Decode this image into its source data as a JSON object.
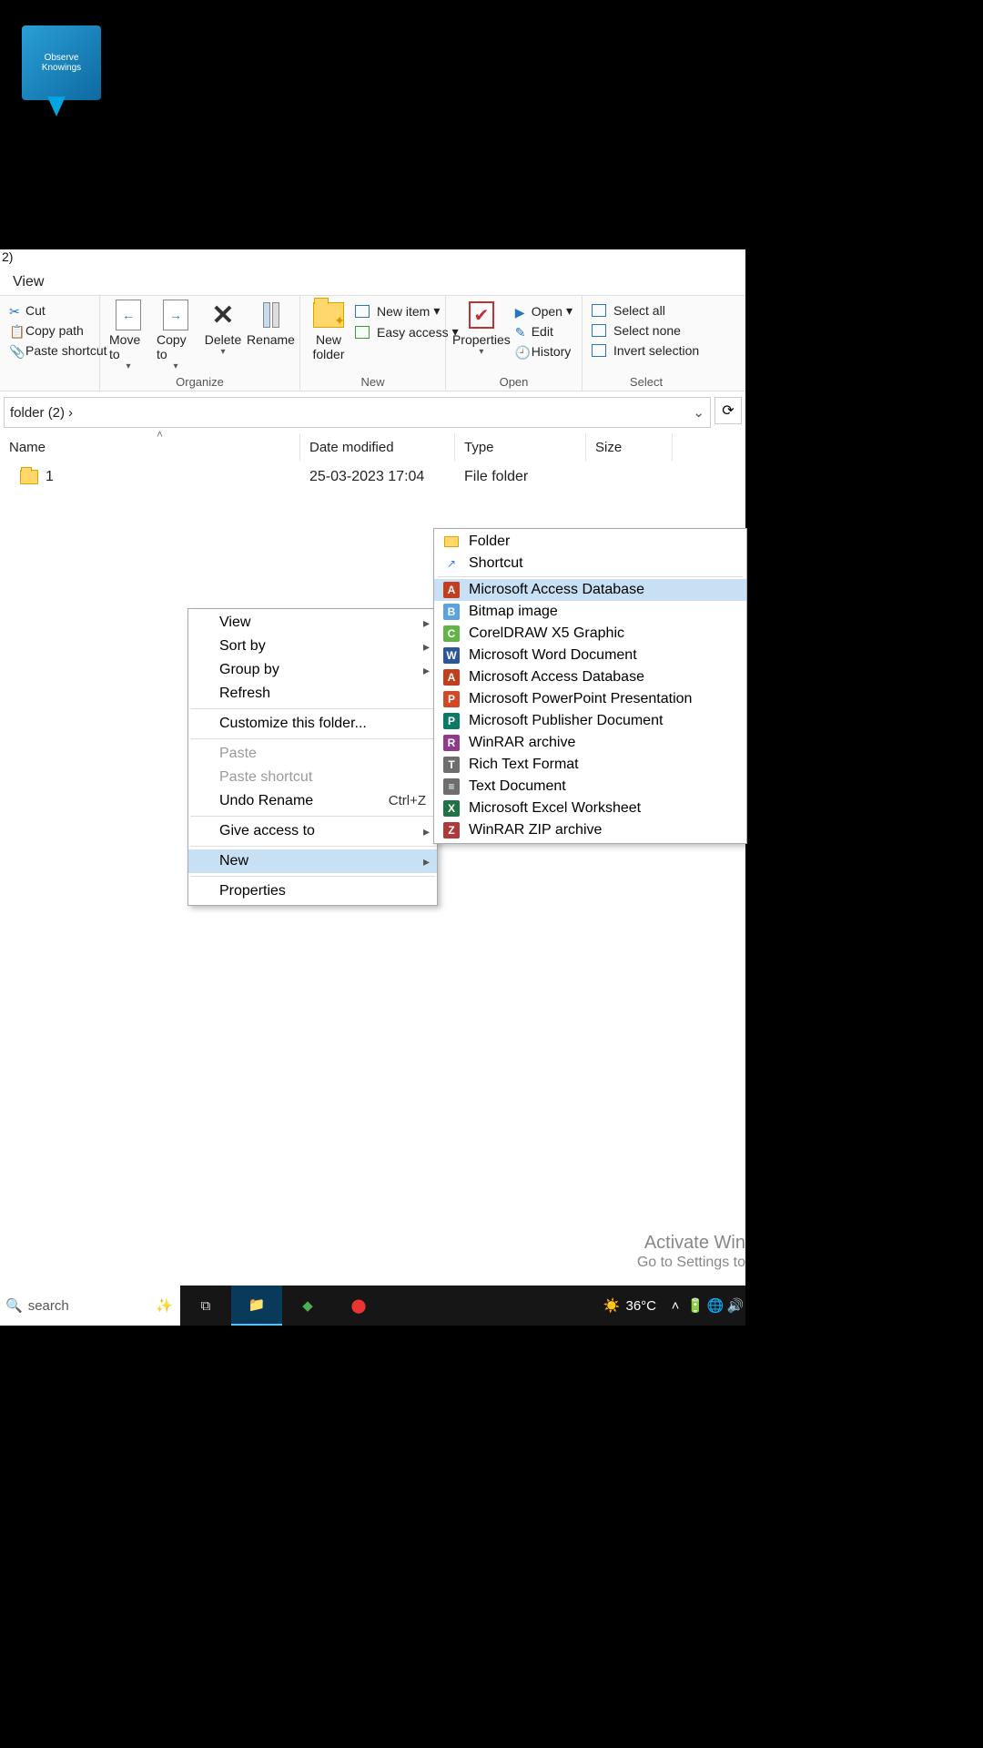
{
  "desktop": {
    "icon_label": "Observe Knowings"
  },
  "title": "2)",
  "tabs": {
    "view": "View"
  },
  "ribbon": {
    "clipboard": {
      "cut": "Cut",
      "copy_path": "Copy path",
      "paste_shortcut": "Paste shortcut"
    },
    "organize": {
      "move_to": "Move to",
      "copy_to": "Copy to",
      "delete": "Delete",
      "rename": "Rename",
      "group": "Organize"
    },
    "new": {
      "new_folder": "New folder",
      "new_item": "New item",
      "easy_access": "Easy access",
      "group": "New"
    },
    "open": {
      "properties": "Properties",
      "open": "Open",
      "edit": "Edit",
      "history": "History",
      "group": "Open"
    },
    "select": {
      "select_all": "Select all",
      "select_none": "Select none",
      "invert": "Invert selection",
      "group": "Select"
    }
  },
  "address": {
    "crumb": "folder (2)",
    "chev": "›"
  },
  "columns": {
    "name": "Name",
    "date": "Date modified",
    "type": "Type",
    "size": "Size"
  },
  "rows": [
    {
      "name": "1",
      "date": "25-03-2023 17:04",
      "type": "File folder"
    }
  ],
  "context_menu": {
    "items": [
      {
        "label": "View",
        "sub": true
      },
      {
        "label": "Sort by",
        "sub": true
      },
      {
        "label": "Group by",
        "sub": true
      },
      {
        "label": "Refresh"
      },
      {
        "sep": true
      },
      {
        "label": "Customize this folder..."
      },
      {
        "sep": true
      },
      {
        "label": "Paste",
        "disabled": true
      },
      {
        "label": "Paste shortcut",
        "disabled": true
      },
      {
        "label": "Undo Rename",
        "kb": "Ctrl+Z"
      },
      {
        "sep": true
      },
      {
        "label": "Give access to",
        "sub": true
      },
      {
        "sep": true
      },
      {
        "label": "New",
        "sub": true,
        "highlight": true
      },
      {
        "sep": true
      },
      {
        "label": "Properties"
      }
    ]
  },
  "new_submenu": [
    {
      "label": "Folder",
      "icon": "folder",
      "color": "#ffd76a"
    },
    {
      "label": "Shortcut",
      "icon": "shortcut",
      "color": "#3a7bd5"
    },
    {
      "sep": true
    },
    {
      "label": "Microsoft Access Database",
      "icon": "A",
      "color": "#c43e1c",
      "hl": true
    },
    {
      "label": "Bitmap image",
      "icon": "B",
      "color": "#5aa3e0"
    },
    {
      "label": "CorelDRAW X5 Graphic",
      "icon": "C",
      "color": "#63b446"
    },
    {
      "label": "Microsoft Word Document",
      "icon": "W",
      "color": "#2b579a"
    },
    {
      "label": "Microsoft Access Database",
      "icon": "A",
      "color": "#c43e1c"
    },
    {
      "label": "Microsoft PowerPoint Presentation",
      "icon": "P",
      "color": "#d24726"
    },
    {
      "label": "Microsoft Publisher Document",
      "icon": "P",
      "color": "#087a66"
    },
    {
      "label": "WinRAR archive",
      "icon": "R",
      "color": "#8e3a8e"
    },
    {
      "label": "Rich Text Format",
      "icon": "T",
      "color": "#6e6e6e"
    },
    {
      "label": "Text Document",
      "icon": "≡",
      "color": "#6e6e6e"
    },
    {
      "label": "Microsoft Excel Worksheet",
      "icon": "X",
      "color": "#217346"
    },
    {
      "label": "WinRAR ZIP archive",
      "icon": "Z",
      "color": "#b03a3a"
    }
  ],
  "watermark": {
    "line1": "Activate Win",
    "line2": "Go to Settings to"
  },
  "taskbar": {
    "search": "search",
    "temp": "36°C"
  }
}
